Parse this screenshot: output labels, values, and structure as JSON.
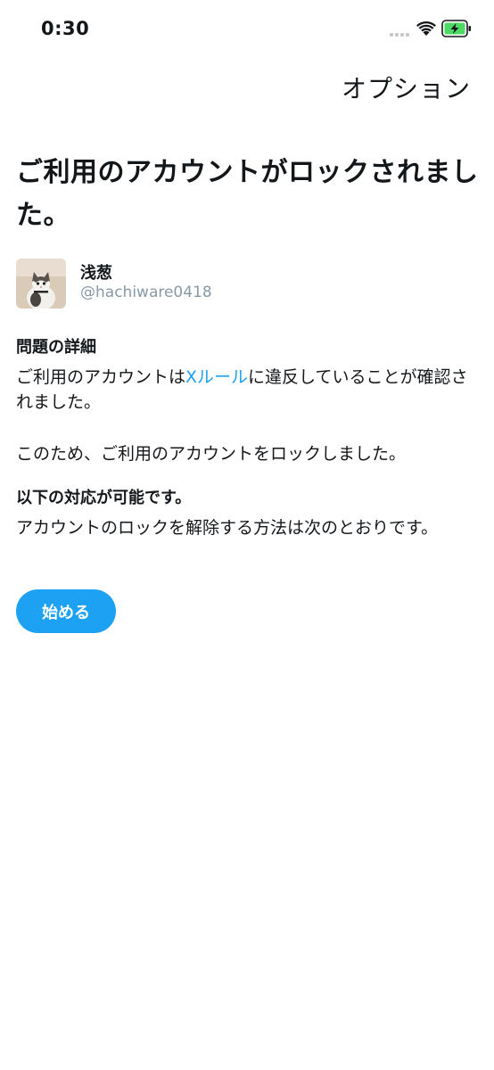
{
  "status_bar": {
    "time": "0:30",
    "icons": [
      "signal-dots-icon",
      "wifi-icon",
      "battery-charging-icon"
    ],
    "battery_color": "#4cd964"
  },
  "header": {
    "options_label": "オプション"
  },
  "title": "ご利用のアカウントがロックされました。",
  "profile": {
    "display_name": "浅葱",
    "handle": "@hachiware0418",
    "avatar_icon": "cat-photo-avatar"
  },
  "details": {
    "heading": "問題の詳細",
    "body_prefix": "ご利用のアカウントは",
    "body_link": "Xルール",
    "body_suffix": "に違反していることが確認されました。",
    "body2": "このため、ご利用のアカウントをロックしました。"
  },
  "actions": {
    "heading": "以下の対応が可能です。",
    "body": "アカウントのロックを解除する方法は次のとおりです。"
  },
  "start_button_label": "始める",
  "colors": {
    "accent": "#1da1f2",
    "text": "#14171a",
    "secondary_text": "#8899a6"
  }
}
